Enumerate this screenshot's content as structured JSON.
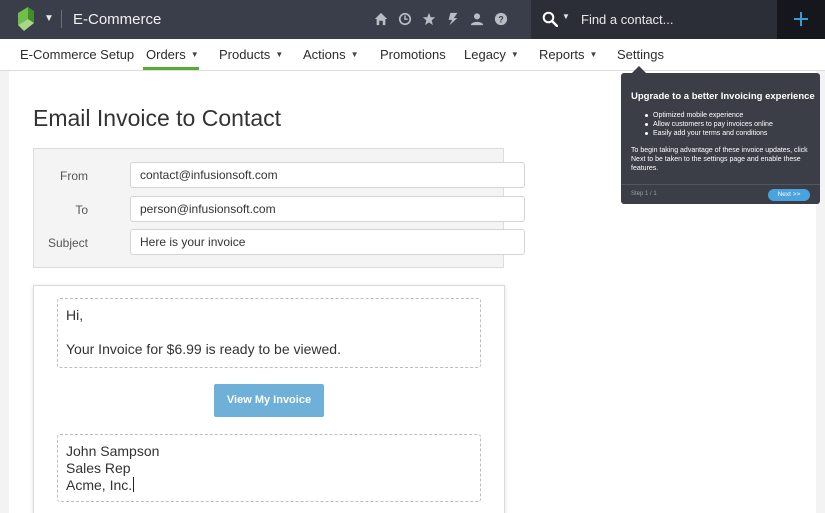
{
  "header": {
    "app_title": "E-Commerce",
    "logo_icon": "infusionsoft-leaf-icon",
    "icons": [
      "home-icon",
      "clock-icon",
      "star-icon",
      "lightning-icon",
      "user-icon",
      "help-icon"
    ],
    "search": {
      "placeholder": "Find a contact..."
    },
    "add_icon": "plus-icon",
    "colors": {
      "bar": "#3a3e4a",
      "search_bg": "#2b2e37",
      "plus_bg": "#16171c",
      "plus_accent": "#3a9bd9"
    }
  },
  "nav": {
    "items": [
      {
        "label": "E-Commerce Setup",
        "dropdown": false
      },
      {
        "label": "Orders",
        "dropdown": true,
        "active": true
      },
      {
        "label": "Products",
        "dropdown": true
      },
      {
        "label": "Actions",
        "dropdown": true
      },
      {
        "label": "Promotions",
        "dropdown": false
      },
      {
        "label": "Legacy",
        "dropdown": true
      },
      {
        "label": "Reports",
        "dropdown": true
      },
      {
        "label": "Settings",
        "dropdown": false
      }
    ],
    "active_color": "#5aa93a"
  },
  "page": {
    "title": "Email Invoice to Contact",
    "from_label": "From",
    "from_value": "contact@infusionsoft.com",
    "to_label": "To",
    "to_value": "person@infusionsoft.com",
    "subject_label": "Subject",
    "subject_value": "Here is your invoice"
  },
  "email": {
    "greeting": "Hi,",
    "message": "Your Invoice for $6.99 is ready to be viewed.",
    "button_label": "View My Invoice",
    "button_color": "#6fb0d9",
    "signature": [
      "John Sampson",
      "Sales Rep",
      "Acme, Inc."
    ]
  },
  "tooltip": {
    "title": "Upgrade to a better Invoicing experience",
    "bullets": [
      "Optimized mobile experience",
      "Allow customers to pay invoices online",
      "Easily add your terms and conditions"
    ],
    "description": "To begin taking advantage of these invoice updates, click Next to be taken to the settings page and enable these features.",
    "step": "Step 1 / 1",
    "next_label": "Next >>",
    "colors": {
      "bg": "#3b3e46",
      "next": "#4aa3df"
    }
  }
}
